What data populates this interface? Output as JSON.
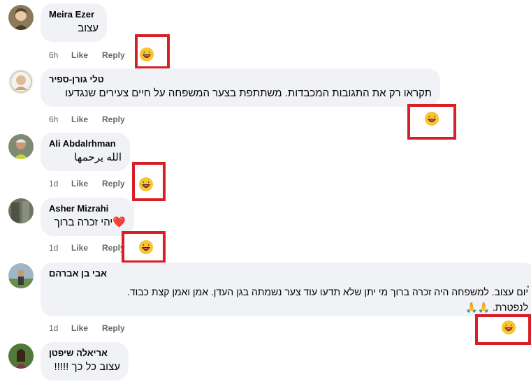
{
  "comments": [
    {
      "author": "Meira Ezer",
      "text": "עצוב",
      "time": "6h",
      "like": "Like",
      "reply": "Reply",
      "reaction": "laughing-emoji"
    },
    {
      "author": "טלי גורן-ספיר",
      "text": "תקראו רק את התגובות המכבדות. משתתפת בצער המשפחה על חיים צעירים שנגדעו",
      "time": "6h",
      "like": "Like",
      "reply": "Reply",
      "reaction": "laughing-emoji"
    },
    {
      "author": "Ali Abdalrhman",
      "text": "الله يرحمها",
      "time": "1d",
      "like": "Like",
      "reply": "Reply",
      "reaction": "laughing-emoji"
    },
    {
      "author": "Asher Mizrahi",
      "text": "יהי זכרה ברוך",
      "heart": "❤️",
      "time": "1d",
      "like": "Like",
      "reply": "Reply",
      "reaction": "laughing-emoji"
    },
    {
      "author": "אבי בן אברהם",
      "text_line1": "יום עצוב. למשפחה היה זכרה ברוך מי יתן שלא תדעו עוד צער נשמתה בגן העדן. אמן ואמן קצת כבוד.",
      "text_line2": "לנפטרת. 🙏🙏",
      "time": "1d",
      "like": "Like",
      "reply": "Reply",
      "reaction": "laughing-emoji"
    },
    {
      "author": "אריאלה שיפטן",
      "text": "עצוב כל כך !!!!!",
      "time": "",
      "like": "",
      "reply": ""
    }
  ],
  "colors": {
    "highlight_border": "#d91f26",
    "bubble_bg": "#f0f2f5",
    "meta_text": "#65676b"
  }
}
